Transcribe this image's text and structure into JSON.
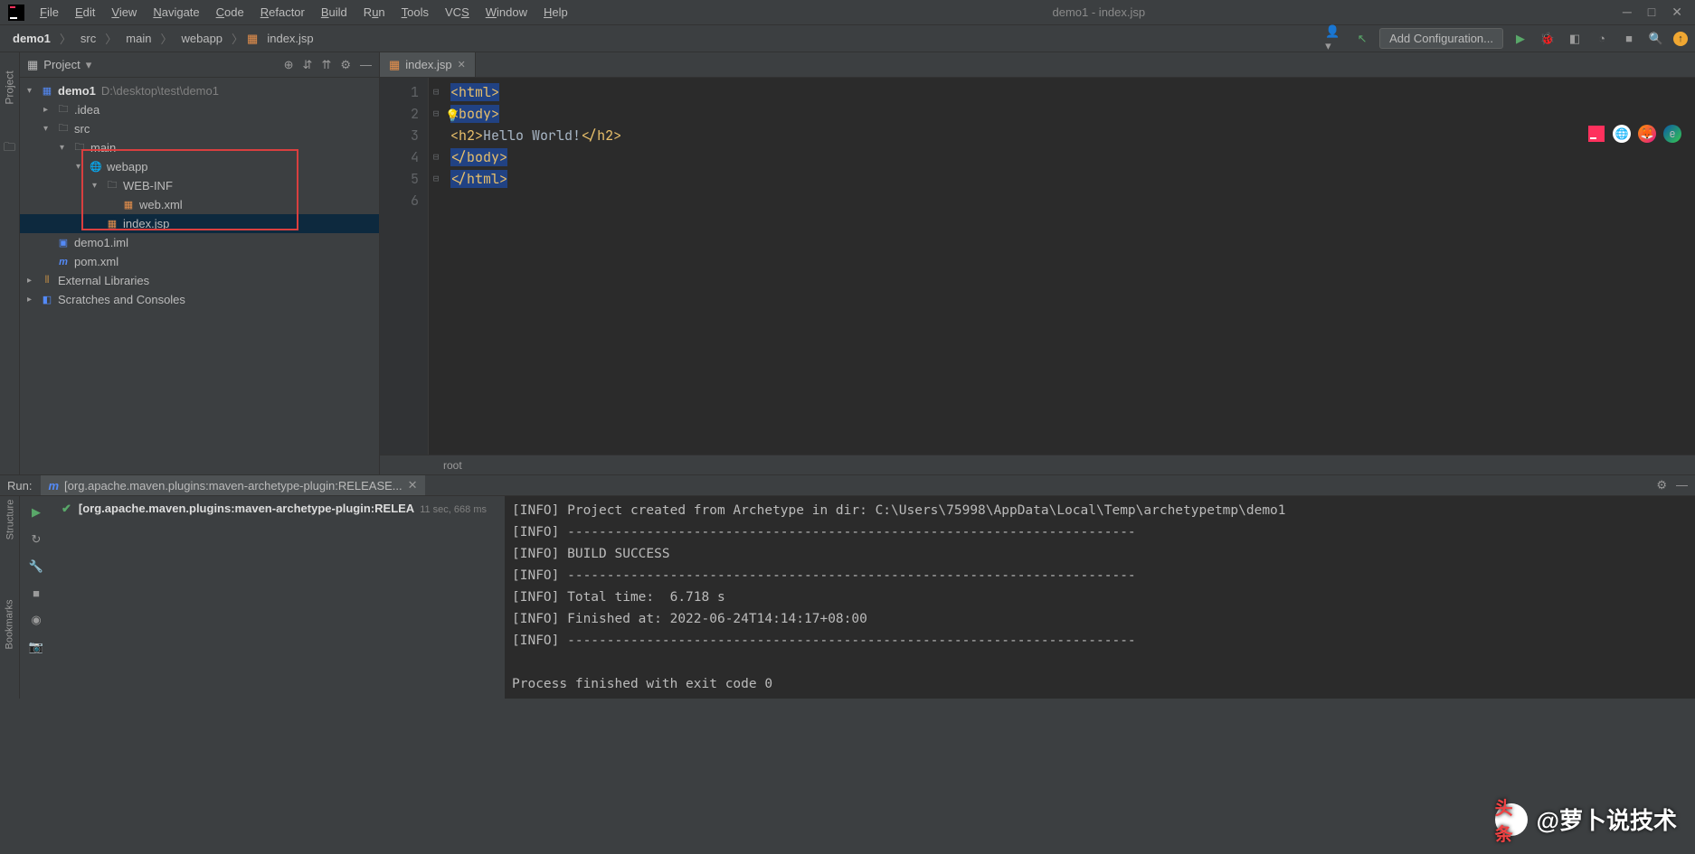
{
  "window": {
    "title": "demo1 - index.jsp",
    "minimize": "─",
    "maximize": "□",
    "close": "✕"
  },
  "menu": [
    "File",
    "Edit",
    "View",
    "Navigate",
    "Code",
    "Refactor",
    "Build",
    "Run",
    "Tools",
    "VCS",
    "Window",
    "Help"
  ],
  "breadcrumb": [
    "demo1",
    "src",
    "main",
    "webapp",
    "index.jsp"
  ],
  "toolbar": {
    "add_config": "Add Configuration..."
  },
  "project": {
    "title": "Project",
    "tree": {
      "root": {
        "name": "demo1",
        "path": "D:\\desktop\\test\\demo1"
      },
      "idea": ".idea",
      "src": "src",
      "main": "main",
      "webapp": "webapp",
      "webinf": "WEB-INF",
      "webxml": "web.xml",
      "indexjsp": "index.jsp",
      "iml": "demo1.iml",
      "pom": "pom.xml",
      "ext": "External Libraries",
      "scratch": "Scratches and Consoles"
    }
  },
  "editor": {
    "tab": "index.jsp",
    "lines": [
      "1",
      "2",
      "3",
      "4",
      "5",
      "6"
    ],
    "code": {
      "l1": {
        "open": "<",
        "tag": "html",
        "close": ">"
      },
      "l2": {
        "open": "<",
        "tag": "body",
        "close": ">"
      },
      "l3": {
        "open1": "<",
        "tag1": "h2",
        "close1": ">",
        "text": "Hello World!",
        "open2": "</",
        "tag2": "h2",
        "close2": ">"
      },
      "l4": {
        "open": "</",
        "tag": "body",
        "close": ">"
      },
      "l5": {
        "open": "</",
        "tag": "html",
        "close": ">"
      }
    },
    "breadcrumb_bottom": "root"
  },
  "run": {
    "label": "Run:",
    "tab": "[org.apache.maven.plugins:maven-archetype-plugin:RELEASE...",
    "status": "[org.apache.maven.plugins:maven-archetype-plugin:RELEA",
    "duration": "11 sec, 668 ms",
    "console_lines": [
      "[INFO] Project created from Archetype in dir: C:\\Users\\75998\\AppData\\Local\\Temp\\archetypetmp\\demo1",
      "[INFO] ------------------------------------------------------------------------",
      "[INFO] BUILD SUCCESS",
      "[INFO] ------------------------------------------------------------------------",
      "[INFO] Total time:  6.718 s",
      "[INFO] Finished at: 2022-06-24T14:14:17+08:00",
      "[INFO] ------------------------------------------------------------------------",
      "",
      "Process finished with exit code 0"
    ]
  },
  "rails": {
    "project": "Project",
    "structure": "Structure",
    "bookmarks": "Bookmarks"
  },
  "watermark": "@萝卜说技术",
  "watermark_prefix": "头条"
}
